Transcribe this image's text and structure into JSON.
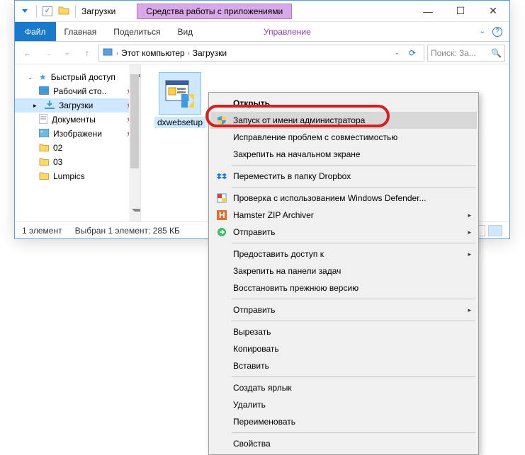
{
  "title": "Загрузки",
  "ribbonFlag": "Средства работы с приложениями",
  "ribbon": {
    "file": "Файл",
    "main": "Главная",
    "share": "Поделиться",
    "view": "Вид",
    "manage": "Управление"
  },
  "address": {
    "seg1": "Этот компьютер",
    "seg2": "Загрузки"
  },
  "search": {
    "placeholder": "Поиск: За..."
  },
  "sidebar": {
    "quick": "Быстрый доступ",
    "desktop": "Рабочий сто..",
    "downloads": "Загрузки",
    "documents": "Документы",
    "pictures": "Изображени",
    "f02": "02",
    "f03": "03",
    "lumpics": "Lumpics"
  },
  "file": {
    "name": "dxwebsetup"
  },
  "status": {
    "count": "1 элемент",
    "selected": "Выбран 1 элемент: 285 КБ"
  },
  "ctx": {
    "open": "Открыть",
    "runas": "Запуск от имени администратора",
    "compat": "Исправление проблем с совместимостью",
    "pinstart": "Закрепить на начальном экране",
    "dropbox": "Переместить в папку Dropbox",
    "defender": "Проверка с использованием Windows Defender...",
    "hamster": "Hamster ZIP Archiver",
    "sendto1": "Отправить",
    "access": "Предоставить доступ к",
    "pintask": "Закрепить на панели задач",
    "restore": "Восстановить прежнюю версию",
    "sendto2": "Отправить",
    "cut": "Вырезать",
    "copy": "Копировать",
    "paste": "Вставить",
    "shortcut": "Создать ярлык",
    "delete": "Удалить",
    "rename": "Переименовать",
    "props": "Свойства"
  }
}
